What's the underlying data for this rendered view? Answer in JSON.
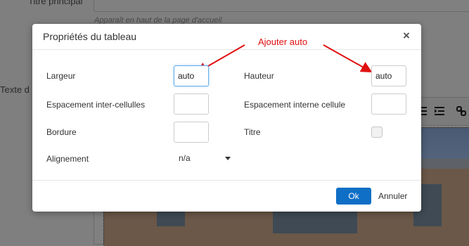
{
  "background": {
    "title_label": "Titre principal",
    "title_hint": "Apparaît en haut de la page d'accueil",
    "text_label": "Texte d"
  },
  "dialog": {
    "title": "Propriétés du tableau",
    "close_symbol": "×",
    "annotation": "Ajouter auto",
    "fields": {
      "width_label": "Largeur",
      "width_value": "auto",
      "height_label": "Hauteur",
      "height_value": "auto",
      "cellspacing_label": "Espacement inter-cellulles",
      "cellspacing_value": "",
      "cellpadding_label": "Espacement interne cellule",
      "cellpadding_value": "",
      "border_label": "Bordure",
      "border_value": "",
      "caption_label": "Titre",
      "caption_checked": false,
      "align_label": "Alignement",
      "align_value": "n/a"
    },
    "ok_label": "Ok",
    "cancel_label": "Annuler"
  },
  "colors": {
    "primary_button": "#0f6fc6",
    "annotation": "#e01010",
    "overlay": "#7f7f7f"
  }
}
